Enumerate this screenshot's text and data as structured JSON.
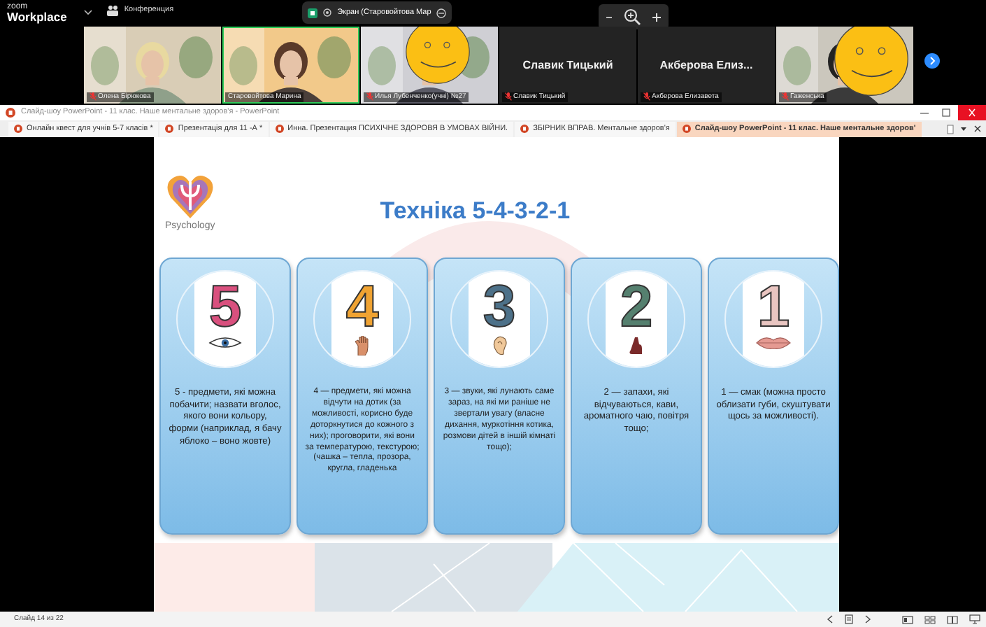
{
  "zoom_bar": {
    "logo_top": "zoom",
    "logo_bottom": "Workplace",
    "meeting_label": "Конференция",
    "share_pill": "Экран (Старовойтова Мар",
    "tiles": [
      {
        "kind": "video",
        "name": "Олена Бірюкова",
        "muted": true,
        "speaking": false,
        "sticker": false
      },
      {
        "kind": "video",
        "name": "Старовойтова Марина",
        "muted": false,
        "speaking": true,
        "sticker": false
      },
      {
        "kind": "video",
        "name": "Илья Лубенченко(учні) №27",
        "muted": true,
        "speaking": false,
        "sticker": true
      },
      {
        "kind": "name",
        "display_name": "Славик Тицький",
        "name": "Славик Тицький",
        "muted": true,
        "speaking": false,
        "sticker": false
      },
      {
        "kind": "name",
        "display_name": "Акберова  Елиз...",
        "name": "Акберова Елизавета",
        "muted": true,
        "speaking": false,
        "sticker": false
      },
      {
        "kind": "video",
        "name": "Гаженська",
        "muted": true,
        "speaking": false,
        "sticker": true
      }
    ]
  },
  "window": {
    "title": "Слайд-шоу PowerPoint  -  11 клас. Наше ментальне здоров'я  -  PowerPoint"
  },
  "tabs": [
    {
      "label": "Онлайн квест для учнів 5-7 класів *",
      "selected": false
    },
    {
      "label": "Презентація для 11 -А *",
      "selected": false
    },
    {
      "label": "Инна. Презентация ПСИХІЧНЕ ЗДОРОВЯ В УМОВАХ ВІЙНИ.",
      "selected": false
    },
    {
      "label": "ЗБІРНИК  ВПРАВ. Ментальне здоров'я",
      "selected": false
    },
    {
      "label": "Слайд-шоу PowerPoint  -  11 клас. Наше ментальне здоров'",
      "selected": true
    }
  ],
  "slide": {
    "logo_text": "Psychology",
    "title": "Техніка  5-4-3-2-1",
    "cards": [
      {
        "number": "5",
        "color": "#d9507e",
        "text": "5 - предмети, які можна побачити; назвати вголос, якого вони кольору, форми (наприклад, я бачу яблоко – воно жовте)"
      },
      {
        "number": "4",
        "color": "#f0a332",
        "text": "4 — предмети, які можна відчути на дотик (за можливості, корисно буде доторкнутися до кожного з них); проговорити, які вони за температурою, текстурою; (чашка – тепла, прозора, кругла, гладенька"
      },
      {
        "number": "3",
        "color": "#4d7189",
        "text": "3 — звуки, які лунають саме зараз, на які ми раніше не звертали увагу (власне дихання, муркотіння котика, розмови дітей в іншій кімнаті тощо);"
      },
      {
        "number": "2",
        "color": "#55806f",
        "text": "2 — запахи, які відчуваються, кави, ароматного чаю, повітря тощо;"
      },
      {
        "number": "1",
        "color": "#e9c5c1",
        "text": "1 — смак (можна просто облизати губи, скуштувати щось за можливості)."
      }
    ]
  },
  "status_bar": {
    "slide_counter": "Слайд 14 из 22"
  }
}
